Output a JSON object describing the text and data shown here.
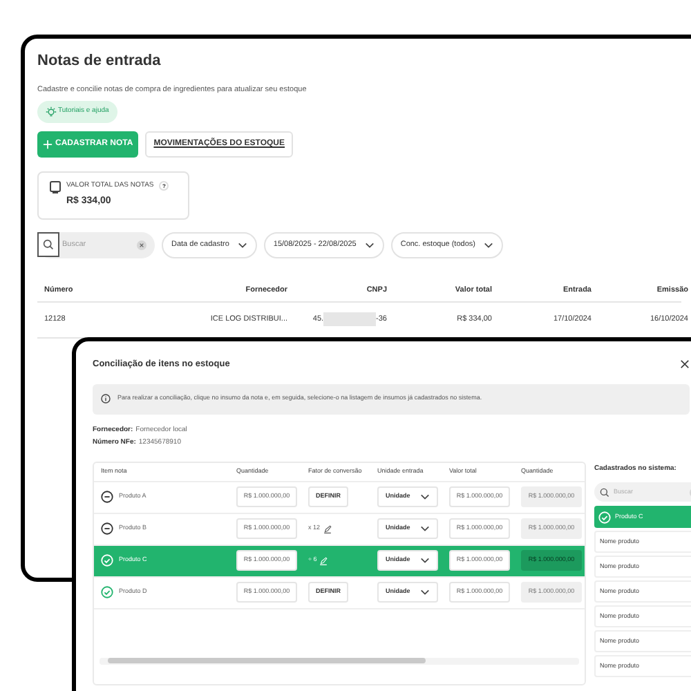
{
  "page": {
    "title": "Notas de entrada",
    "subtitle": "Cadastre e concilie notas de compra de ingredientes para atualizar seu estoque",
    "help_chip": "Tutoriais e ajuda",
    "primary_button": "CADASTRAR NOTA",
    "secondary_button": "MOVIMENTAÇÕES DO ESTOQUE",
    "total_card": {
      "label": "VALOR TOTAL DAS NOTAS",
      "help": "?",
      "value": "R$ 334,00"
    },
    "search": {
      "placeholder": "Buscar"
    },
    "filters": [
      "Data de cadastro",
      "15/08/2025 - 22/08/2025",
      "Conc. estoque (todos)"
    ],
    "table": {
      "columns": [
        "Número",
        "Fornecedor",
        "CNPJ",
        "Valor total",
        "Entrada",
        "Emissão"
      ],
      "rows": [
        {
          "numero": "12128",
          "fornecedor": "ICE LOG DISTRIBUI...",
          "cnpj_start": "45.",
          "cnpj_end": "-36",
          "valor": "R$ 334,00",
          "entrada": "17/10/2024",
          "emissao": "16/10/2024"
        }
      ]
    }
  },
  "modal": {
    "title": "Conciliação de itens no estoque",
    "info": "Para realizar a conciliação, clique no insumo da nota e, em seguida, selecione-o na listagem de insumos já cadastrados no sistema.",
    "fornecedor_label": "Fornecedor:",
    "fornecedor": "Fornecedor local",
    "nfe_label": "Número NFe:",
    "nfe": "12345678910",
    "columns": [
      "Item nota",
      "Quantidade",
      "Fator de conversão",
      "Unidade entrada",
      "Valor total",
      "Quantidade"
    ],
    "rows": [
      {
        "kind": "pending",
        "name": "Produto A",
        "quantidade": "R$ 1.000.000,00",
        "fator": {
          "kind": "button",
          "text": "DEFINIR"
        },
        "unidade": "Unidade",
        "valor": "R$ 1.000.000,00",
        "quantidade_sistema": "R$ 1.000.000,00",
        "selected": false
      },
      {
        "kind": "pending",
        "name": "Produto B",
        "quantidade": "R$ 1.000.000,00",
        "fator": {
          "kind": "text",
          "text": "x 12"
        },
        "unidade": "Unidade",
        "valor": "R$ 1.000.000,00",
        "quantidade_sistema": "R$ 1.000.000,00",
        "selected": false
      },
      {
        "kind": "matched",
        "name": "Produto C",
        "quantidade": "R$ 1.000.000,00",
        "fator": {
          "kind": "text",
          "text": "÷ 6"
        },
        "unidade": "Unidade",
        "valor": "R$ 1.000.000,00",
        "quantidade_sistema": "R$ 1.000.000,00",
        "selected": true
      },
      {
        "kind": "matched",
        "name": "Produto D",
        "quantidade": "R$ 1.000.000,00",
        "fator": {
          "kind": "button",
          "text": "DEFINIR"
        },
        "unidade": "Unidade",
        "valor": "R$ 1.000.000,00",
        "quantidade_sistema": "R$ 1.000.000,00",
        "selected": false
      }
    ],
    "system_panel": {
      "title": "Cadastrados no sistema:",
      "search_placeholder": "Buscar",
      "items": [
        {
          "name": "Produto C",
          "selected": true
        },
        {
          "name": "Nome produto",
          "selected": false
        },
        {
          "name": "Nome produto",
          "selected": false
        },
        {
          "name": "Nome produto",
          "selected": false
        },
        {
          "name": "Nome produto",
          "selected": false
        },
        {
          "name": "Nome produto",
          "selected": false
        },
        {
          "name": "Nome produto",
          "selected": false
        }
      ]
    }
  }
}
